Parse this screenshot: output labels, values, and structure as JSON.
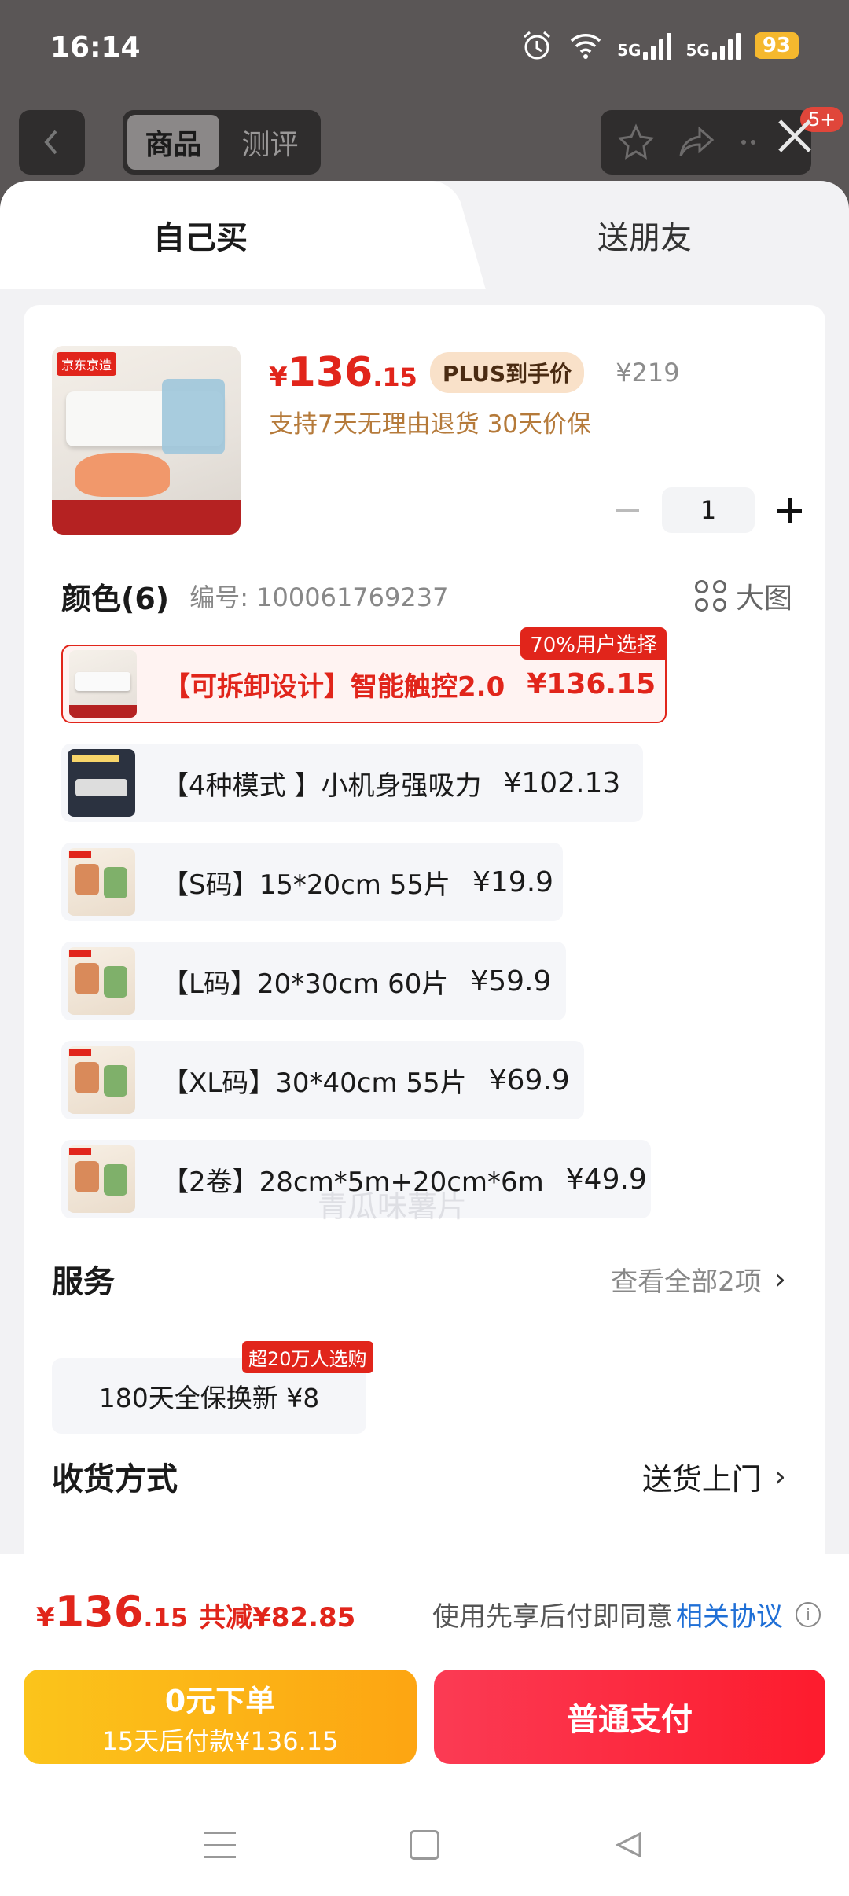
{
  "status": {
    "time": "16:14",
    "net1": "5G",
    "net2": "5G",
    "battery": "93"
  },
  "top_nav": {
    "tabs": [
      "商品",
      "测评"
    ],
    "badge": "5+"
  },
  "sheet": {
    "tab_self": "自己买",
    "tab_friend": "送朋友"
  },
  "product": {
    "thumb_logo": "京东京造",
    "price_symbol": "¥",
    "price_int": "136",
    "price_dec": ".15",
    "plus_tag": "PLUS到手价",
    "orig_price": "¥219",
    "promise": "支持7天无理由退货  30天价保",
    "quantity": "1"
  },
  "color": {
    "title": "颜色(6)",
    "sku": "编号: 100061769237",
    "big_pic": "大图",
    "options": [
      {
        "label": "【可拆卸设计】智能触控2.0",
        "price": "¥136.15",
        "badge": "70%用户选择"
      },
      {
        "label": "【4种模式 】小机身强吸力",
        "price": "¥102.13"
      },
      {
        "label": "【S码】15*20cm 55片",
        "price": "¥19.9"
      },
      {
        "label": "【L码】20*30cm 60片",
        "price": "¥59.9"
      },
      {
        "label": "【XL码】30*40cm 55片",
        "price": "¥69.9"
      },
      {
        "label": "【2卷】28cm*5m+20cm*6m",
        "price": "¥49.9"
      }
    ]
  },
  "watermark": "青瓜味薯片",
  "service": {
    "title": "服务",
    "more": "查看全部2项",
    "option": "180天全保换新  ¥8",
    "badge": "超20万人选购"
  },
  "receive": {
    "title": "收货方式",
    "value": "送货上门"
  },
  "bottom": {
    "price_symbol": "¥",
    "price_int": "136",
    "price_dec": ".15",
    "saving": "共减¥82.85",
    "agree_text": "使用先享后付即同意",
    "agree_link": "相关协议",
    "pay_later_line1": "0元下单",
    "pay_later_line2": "15天后付款¥136.15",
    "pay_button": "普通支付"
  },
  "colors": {
    "accent": "#e1251b",
    "gold": "#fbb21a",
    "pay": "#fd1b2d"
  }
}
